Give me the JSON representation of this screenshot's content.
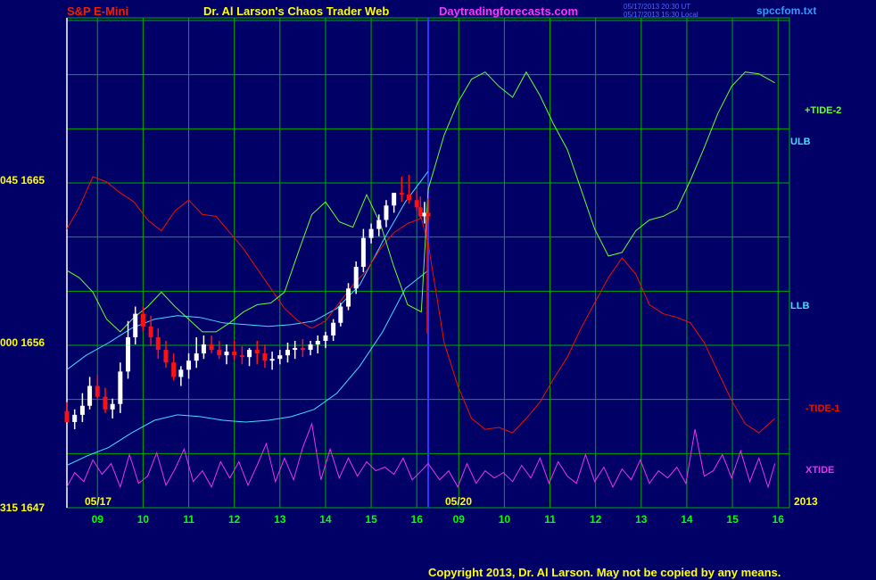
{
  "header": {
    "left_title": "S&P E-Mini",
    "center_title": "Dr. Al Larson's Chaos Trader Web",
    "site": "Daytradingforecasts.com",
    "stamp_ut": "05/17/2013 20:30 UT",
    "stamp_local": "05/17/2013 15:30 Local",
    "file": "spccfom.txt"
  },
  "footer": {
    "copyright": "Copyright 2013, Dr. Al Larson. May not be copied by any means."
  },
  "colors": {
    "background": "#000066",
    "grid": "#00aa00",
    "ulb_llb": "#44ddff",
    "tide2": "#66ff33",
    "tide1": "#ee1100",
    "xtide": "#ee33ee",
    "bar_up": "#ffffff",
    "bar_down": "#ff1111",
    "divider": "#3333ff"
  },
  "chart_data": {
    "type": "line",
    "title": "S&P E-Mini",
    "y_tick_labels": [
      "045  1665",
      "000  1656",
      "315  1647"
    ],
    "y_ticks": [
      1665,
      1656,
      1647
    ],
    "ylim": [
      1647,
      1665
    ],
    "x_tick_labels": [
      "09",
      "10",
      "11",
      "12",
      "13",
      "14",
      "15",
      "16",
      "09",
      "10",
      "11",
      "12",
      "13",
      "14",
      "15",
      "16"
    ],
    "date_labels": [
      "05/17",
      "05/20",
      "2013"
    ],
    "series_labels": {
      "tide2": "+TIDE-2",
      "ulb": "ULB",
      "llb": "LLB",
      "tide1": "-TIDE-1",
      "xtide": "XTIDE"
    },
    "time_axis": {
      "start_hour": 8.33,
      "day1_end_hour": 16.25,
      "day2_end_hour": 16.1,
      "note": "05/17 session 08:20-16:15, then 05/20 forecast 08:20-16:05"
    },
    "price_bars": {
      "t": [
        8.33,
        8.5,
        8.67,
        8.83,
        9.0,
        9.17,
        9.33,
        9.5,
        9.67,
        9.83,
        10.0,
        10.17,
        10.33,
        10.5,
        10.67,
        10.83,
        11.0,
        11.17,
        11.33,
        11.5,
        11.67,
        11.83,
        12.0,
        12.17,
        12.33,
        12.5,
        12.67,
        12.83,
        13.0,
        13.17,
        13.33,
        13.5,
        13.67,
        13.83,
        14.0,
        14.17,
        14.33,
        14.5,
        14.67,
        14.83,
        15.0,
        15.17,
        15.33,
        15.5,
        15.67,
        15.83,
        16.0,
        16.08,
        16.17,
        16.25
      ],
      "open": [
        1652.2,
        1651.6,
        1652.0,
        1652.5,
        1653.6,
        1653.0,
        1652.3,
        1652.6,
        1654.4,
        1656.3,
        1657.6,
        1656.9,
        1656.3,
        1655.6,
        1654.9,
        1654.1,
        1654.5,
        1655.0,
        1655.4,
        1655.9,
        1655.6,
        1655.3,
        1655.5,
        1655.3,
        1655.2,
        1655.6,
        1655.4,
        1655.0,
        1655.1,
        1655.3,
        1655.6,
        1655.7,
        1655.6,
        1655.9,
        1656.1,
        1656.4,
        1657.1,
        1658.0,
        1659.0,
        1660.2,
        1661.8,
        1662.3,
        1662.8,
        1663.6,
        1664.3,
        1664.2,
        1663.9,
        1663.5,
        1663.0,
        1663.2
      ],
      "high": [
        1652.7,
        1652.3,
        1653.2,
        1654.1,
        1654.2,
        1653.5,
        1652.9,
        1654.9,
        1657.2,
        1658.0,
        1658.0,
        1657.5,
        1656.8,
        1656.1,
        1655.4,
        1654.7,
        1655.4,
        1656.3,
        1656.4,
        1656.4,
        1656.1,
        1655.9,
        1656.1,
        1655.8,
        1655.7,
        1656.1,
        1655.9,
        1655.5,
        1655.6,
        1656.0,
        1656.1,
        1656.2,
        1656.1,
        1656.4,
        1656.6,
        1657.3,
        1658.2,
        1659.3,
        1660.5,
        1662.3,
        1662.6,
        1663.1,
        1663.9,
        1664.3,
        1665.2,
        1665.3,
        1664.4,
        1664.1,
        1663.8,
        1664.0
      ],
      "low": [
        1651.7,
        1651.2,
        1651.6,
        1652.3,
        1652.8,
        1652.1,
        1651.8,
        1652.1,
        1654.0,
        1655.9,
        1656.6,
        1655.8,
        1655.1,
        1654.6,
        1653.9,
        1653.6,
        1654.0,
        1654.6,
        1655.1,
        1655.4,
        1655.1,
        1654.8,
        1655.0,
        1654.8,
        1654.7,
        1654.8,
        1654.6,
        1654.5,
        1654.8,
        1654.9,
        1655.1,
        1655.2,
        1655.3,
        1655.4,
        1655.7,
        1656.1,
        1656.9,
        1657.8,
        1658.7,
        1659.9,
        1661.5,
        1661.9,
        1662.4,
        1663.2,
        1663.8,
        1663.7,
        1663.3,
        1662.9,
        1662.6,
        1662.7
      ],
      "close": [
        1651.6,
        1652.0,
        1652.5,
        1653.6,
        1653.0,
        1652.3,
        1652.6,
        1654.4,
        1656.3,
        1657.6,
        1656.9,
        1656.3,
        1655.6,
        1654.9,
        1654.1,
        1654.5,
        1655.0,
        1655.4,
        1655.9,
        1655.6,
        1655.3,
        1655.5,
        1655.3,
        1655.2,
        1655.6,
        1655.4,
        1655.0,
        1655.1,
        1655.3,
        1655.6,
        1655.7,
        1655.6,
        1655.9,
        1656.1,
        1656.4,
        1657.1,
        1658.0,
        1659.0,
        1660.2,
        1661.8,
        1662.3,
        1662.8,
        1663.6,
        1664.3,
        1664.2,
        1663.9,
        1663.5,
        1663.0,
        1663.2,
        1663.0
      ]
    },
    "series": [
      {
        "key": "ulb",
        "t": [
          8.33,
          8.75,
          9.25,
          9.75,
          10.25,
          10.75,
          11.25,
          11.75,
          12.25,
          12.75,
          13.25,
          13.75,
          14.25,
          14.75,
          15.25,
          15.75,
          16.25
        ],
        "y": [
          1654.5,
          1655.3,
          1656.0,
          1656.8,
          1657.3,
          1657.5,
          1657.4,
          1657.1,
          1657.0,
          1656.9,
          1657.0,
          1657.2,
          1657.9,
          1659.2,
          1661.6,
          1663.8,
          1665.5
        ]
      },
      {
        "key": "llb",
        "t": [
          8.33,
          8.75,
          9.25,
          9.75,
          10.25,
          10.75,
          11.25,
          11.75,
          12.25,
          12.75,
          13.25,
          13.75,
          14.25,
          14.75,
          15.25,
          15.75,
          16.25
        ],
        "y": [
          1649.2,
          1649.7,
          1650.2,
          1651.0,
          1651.7,
          1652.0,
          1651.9,
          1651.7,
          1651.6,
          1651.7,
          1651.9,
          1652.3,
          1653.2,
          1654.7,
          1656.6,
          1659.0,
          1660.0
        ]
      },
      {
        "key": "tide1",
        "t": [
          8.33,
          8.6,
          8.9,
          9.2,
          9.5,
          9.8,
          10.1,
          10.4,
          10.7,
          11.0,
          11.3,
          11.6,
          11.9,
          12.2,
          12.5,
          12.8,
          13.1,
          13.4,
          13.7,
          14.0,
          14.3,
          14.6,
          14.9,
          15.2,
          15.5,
          15.8,
          16.1,
          16.25,
          16.6,
          16.9,
          17.2,
          17.5,
          17.8,
          18.1,
          18.4,
          18.7,
          19.0,
          19.3,
          19.6,
          19.9,
          20.2,
          20.5,
          20.8,
          21.1,
          21.4,
          21.7,
          22.0,
          22.3,
          22.6,
          22.9,
          23.2,
          23.5,
          23.85
        ],
        "y": [
          1662.3,
          1663.5,
          1665.2,
          1664.9,
          1664.3,
          1663.8,
          1662.8,
          1662.2,
          1663.3,
          1663.9,
          1663.1,
          1663.0,
          1662.1,
          1661.2,
          1660.1,
          1659.0,
          1657.9,
          1657.2,
          1656.8,
          1657.2,
          1658.2,
          1659.2,
          1660.0,
          1661.2,
          1662.1,
          1662.6,
          1662.9,
          1661.5,
          1656.0,
          1653.6,
          1651.8,
          1651.2,
          1651.3,
          1651.0,
          1651.8,
          1652.7,
          1654.0,
          1655.2,
          1656.8,
          1658.2,
          1659.6,
          1660.7,
          1659.8,
          1658.1,
          1657.6,
          1657.4,
          1657.1,
          1656.0,
          1654.4,
          1652.8,
          1651.5,
          1651.0,
          1651.8
        ]
      },
      {
        "key": "tide2",
        "t": [
          8.33,
          8.6,
          8.9,
          9.2,
          9.5,
          9.8,
          10.1,
          10.4,
          10.7,
          11.0,
          11.3,
          11.6,
          11.9,
          12.2,
          12.5,
          12.8,
          13.1,
          13.4,
          13.7,
          14.0,
          14.3,
          14.6,
          14.9,
          15.2,
          15.5,
          15.8,
          16.1,
          16.25,
          16.6,
          16.9,
          17.2,
          17.5,
          17.8,
          18.1,
          18.4,
          18.7,
          19.0,
          19.3,
          19.6,
          19.9,
          20.2,
          20.5,
          20.8,
          21.1,
          21.4,
          21.7,
          22.0,
          22.3,
          22.6,
          22.9,
          23.2,
          23.5,
          23.85
        ],
        "y": [
          1660.0,
          1659.6,
          1658.8,
          1657.3,
          1656.6,
          1657.4,
          1658.0,
          1658.8,
          1658.0,
          1657.3,
          1656.6,
          1656.6,
          1657.1,
          1657.7,
          1658.1,
          1658.2,
          1658.8,
          1661.0,
          1663.1,
          1663.8,
          1662.7,
          1662.4,
          1664.2,
          1662.6,
          1660.2,
          1658.1,
          1657.7,
          1664.5,
          1667.5,
          1669.3,
          1670.6,
          1671.0,
          1670.2,
          1669.6,
          1671.0,
          1669.7,
          1668.1,
          1666.7,
          1664.5,
          1662.3,
          1660.8,
          1661.0,
          1662.2,
          1662.8,
          1663.0,
          1663.4,
          1665.0,
          1666.8,
          1668.7,
          1670.2,
          1671.0,
          1670.9,
          1670.4
        ]
      },
      {
        "key": "xtide",
        "t": [
          8.33,
          8.5,
          8.7,
          8.9,
          9.1,
          9.3,
          9.5,
          9.7,
          9.9,
          10.1,
          10.3,
          10.5,
          10.7,
          10.9,
          11.1,
          11.3,
          11.5,
          11.7,
          11.9,
          12.1,
          12.3,
          12.5,
          12.7,
          12.9,
          13.1,
          13.3,
          13.5,
          13.7,
          13.9,
          14.1,
          14.3,
          14.5,
          14.7,
          14.9,
          15.1,
          15.3,
          15.5,
          15.7,
          15.9,
          16.1,
          16.25,
          16.5,
          16.7,
          16.9,
          17.1,
          17.3,
          17.5,
          17.7,
          17.9,
          18.1,
          18.3,
          18.5,
          18.7,
          18.9,
          19.1,
          19.3,
          19.5,
          19.7,
          19.9,
          20.1,
          20.3,
          20.5,
          20.7,
          20.9,
          21.1,
          21.3,
          21.5,
          21.7,
          21.9,
          22.1,
          22.3,
          22.5,
          22.7,
          22.9,
          23.1,
          23.3,
          23.5,
          23.7,
          23.85
        ],
        "y": [
          1648.0,
          1648.8,
          1648.3,
          1649.5,
          1648.7,
          1649.3,
          1648.0,
          1649.8,
          1648.2,
          1648.6,
          1649.9,
          1648.1,
          1649.0,
          1650.1,
          1648.3,
          1648.9,
          1648.0,
          1649.4,
          1648.5,
          1649.4,
          1648.1,
          1649.2,
          1650.4,
          1648.3,
          1649.6,
          1648.4,
          1650.2,
          1651.5,
          1648.4,
          1650.1,
          1648.5,
          1649.6,
          1648.6,
          1649.4,
          1648.9,
          1649.1,
          1648.7,
          1649.6,
          1648.4,
          1648.9,
          1649.3,
          1648.4,
          1648.9,
          1648.0,
          1649.3,
          1648.2,
          1648.9,
          1648.5,
          1648.8,
          1648.3,
          1649.2,
          1648.5,
          1649.6,
          1648.2,
          1649.4,
          1648.6,
          1648.2,
          1649.8,
          1648.3,
          1649.1,
          1648.0,
          1649.0,
          1648.4,
          1649.5,
          1648.2,
          1648.9,
          1648.5,
          1649.1,
          1648.2,
          1651.2,
          1648.6,
          1648.9,
          1649.8,
          1648.5,
          1650.0,
          1648.3,
          1649.6,
          1648.0,
          1649.3
        ]
      }
    ]
  }
}
